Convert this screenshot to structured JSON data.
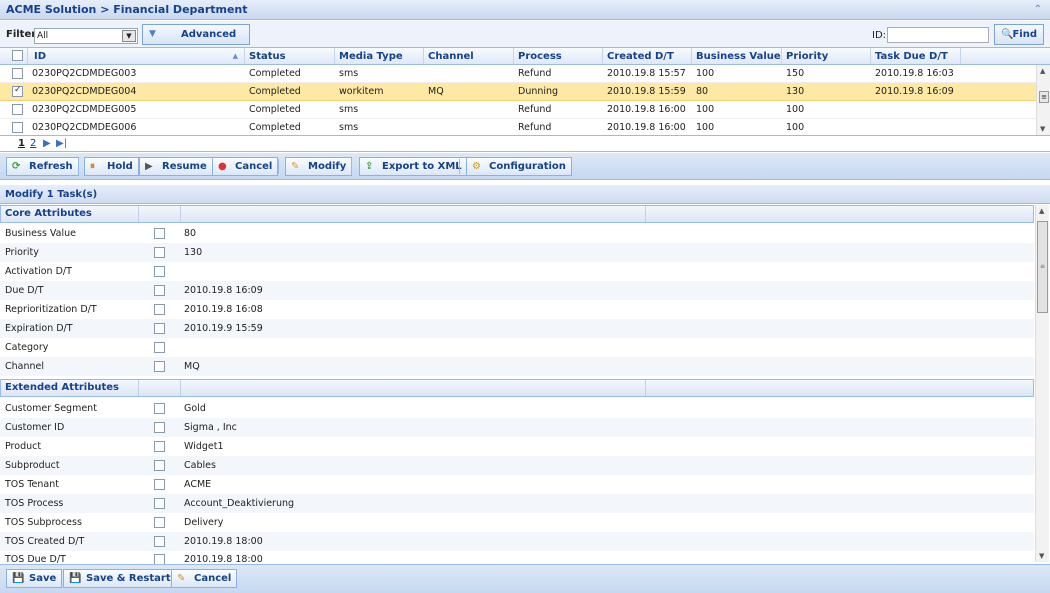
{
  "header": {
    "title": "ACME Solution > Financial Department"
  },
  "filter": {
    "label": "Filter",
    "value": "All",
    "advanced_label": "Advanced",
    "id_label": "ID:",
    "find_label": "Find"
  },
  "grid": {
    "columns": [
      "ID",
      "Status",
      "Media Type",
      "Channel",
      "Process",
      "Created D/T",
      "Business Value",
      "Priority",
      "Task Due D/T"
    ],
    "rows": [
      {
        "id": "0230PQ2CDMDEG003",
        "status": "Completed",
        "media": "sms",
        "channel": "",
        "process": "Refund",
        "created": "2010.19.8 15:57",
        "bv": "100",
        "priority": "150",
        "due": "2010.19.8 16:03",
        "selected": false
      },
      {
        "id": "0230PQ2CDMDEG004",
        "status": "Completed",
        "media": "workitem",
        "channel": "MQ",
        "process": "Dunning",
        "created": "2010.19.8 15:59",
        "bv": "80",
        "priority": "130",
        "due": "2010.19.8 16:09",
        "selected": true
      },
      {
        "id": "0230PQ2CDMDEG005",
        "status": "Completed",
        "media": "sms",
        "channel": "",
        "process": "Refund",
        "created": "2010.19.8 16:00",
        "bv": "100",
        "priority": "100",
        "due": "",
        "selected": false
      },
      {
        "id": "0230PQ2CDMDEG006",
        "status": "Completed",
        "media": "sms",
        "channel": "",
        "process": "Refund",
        "created": "2010.19.8 16:00",
        "bv": "100",
        "priority": "100",
        "due": "",
        "selected": false
      }
    ]
  },
  "pager": {
    "p1": "1",
    "p2": "2"
  },
  "toolbar": {
    "refresh": "Refresh",
    "hold": "Hold",
    "resume": "Resume",
    "cancel": "Cancel",
    "modify": "Modify",
    "export": "Export to XML",
    "config": "Configuration"
  },
  "modify": {
    "title": "Modify 1 Task(s)"
  },
  "core": {
    "title": "Core Attributes",
    "rows": [
      {
        "name": "Business Value",
        "value": "80"
      },
      {
        "name": "Priority",
        "value": "130"
      },
      {
        "name": "Activation D/T",
        "value": ""
      },
      {
        "name": "Due D/T",
        "value": "2010.19.8 16:09"
      },
      {
        "name": "Reprioritization D/T",
        "value": "2010.19.8 16:08"
      },
      {
        "name": "Expiration D/T",
        "value": "2010.19.9 15:59"
      },
      {
        "name": "Category",
        "value": ""
      },
      {
        "name": "Channel",
        "value": "MQ"
      }
    ]
  },
  "extended": {
    "title": "Extended Attributes",
    "rows": [
      {
        "name": "Customer Segment",
        "value": "Gold"
      },
      {
        "name": "Customer ID",
        "value": "Sigma , Inc"
      },
      {
        "name": "Product",
        "value": "Widget1"
      },
      {
        "name": "Subproduct",
        "value": "Cables"
      },
      {
        "name": "TOS Tenant",
        "value": "ACME"
      },
      {
        "name": "TOS Process",
        "value": "Account_Deaktivierung"
      },
      {
        "name": "TOS Subprocess",
        "value": "Delivery"
      },
      {
        "name": "TOS Created D/T",
        "value": "2010.19.8 18:00"
      },
      {
        "name": "TOS Due D/T",
        "value": "2010.19.8 18:00"
      }
    ]
  },
  "bottom": {
    "save": "Save",
    "save_restart": "Save & Restart",
    "cancel": "Cancel"
  }
}
